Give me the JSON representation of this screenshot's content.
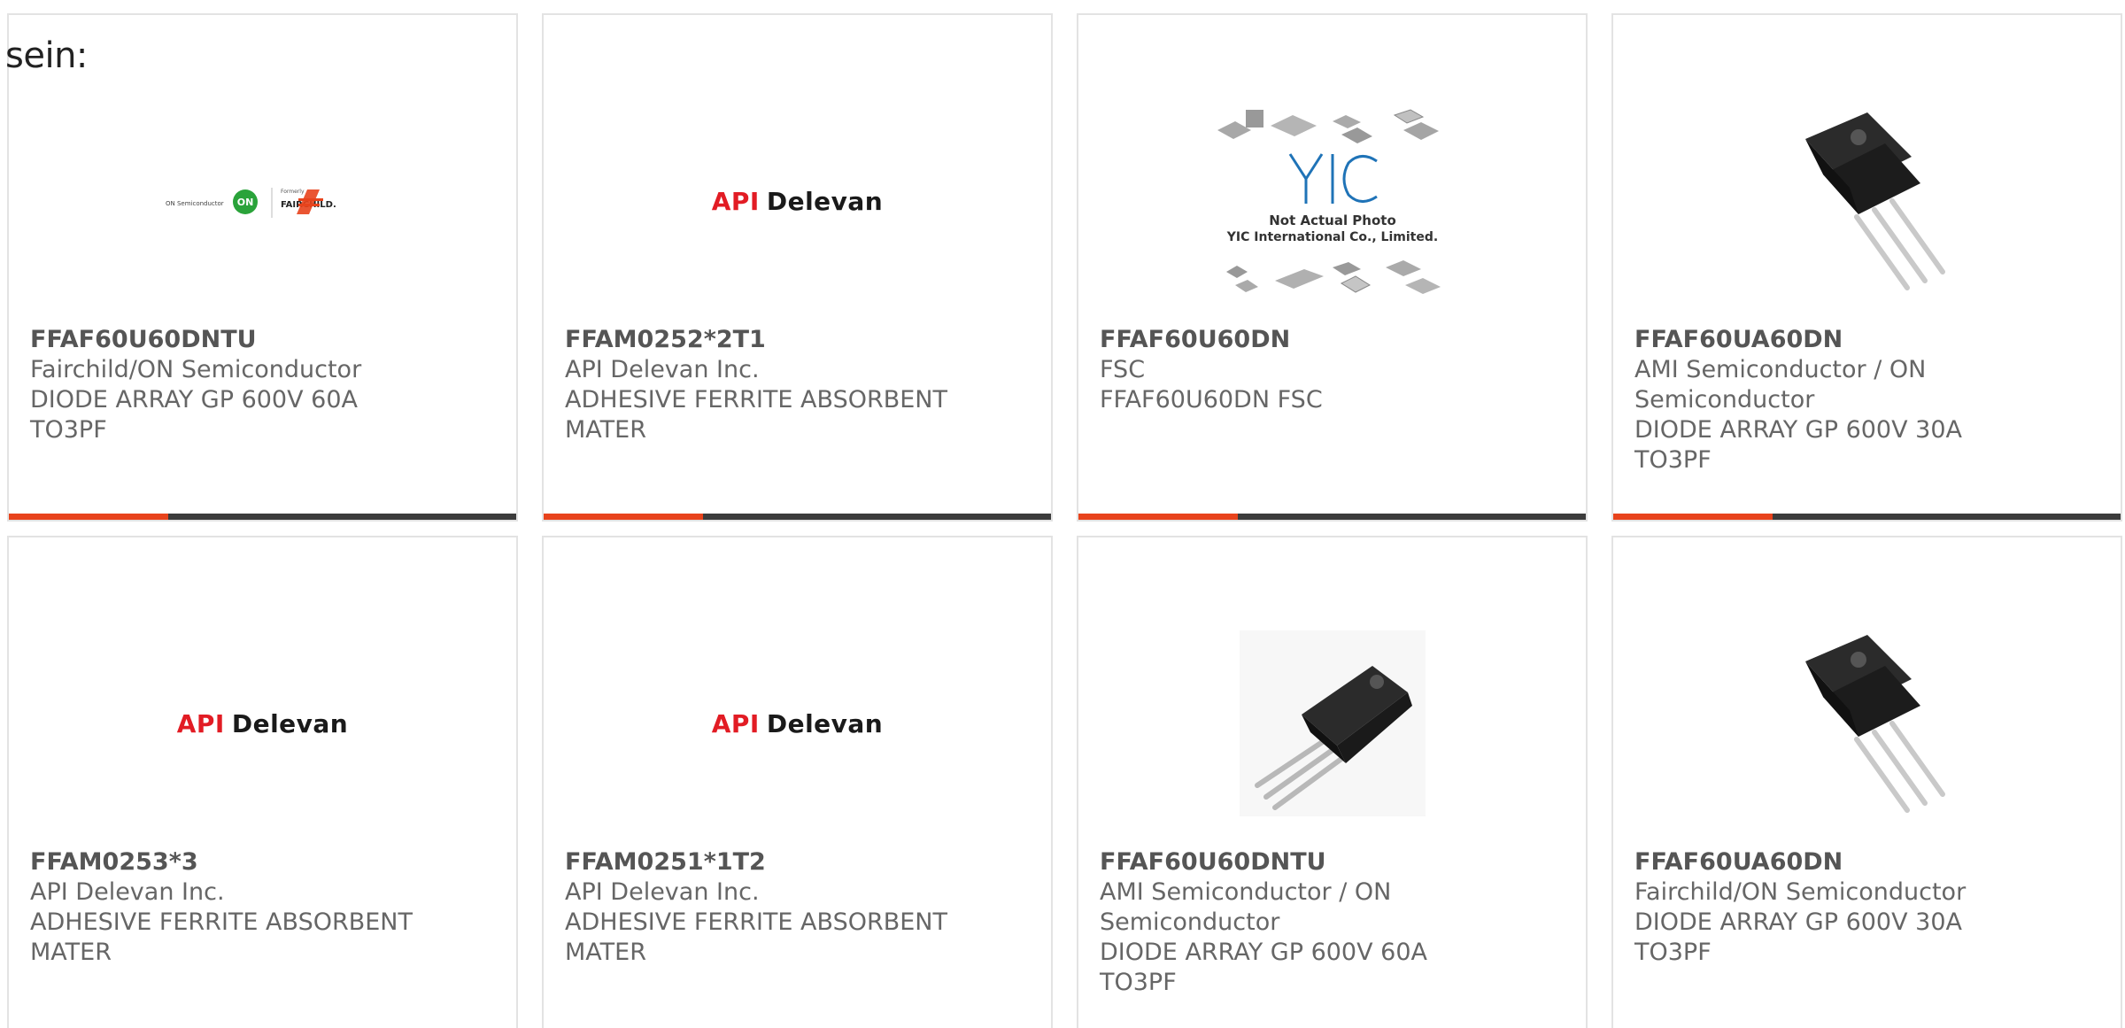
{
  "intro_text": "sein:",
  "colors": {
    "accent": "#e8431c",
    "bar": "#3c3c3c",
    "text": "#666666",
    "api_red": "#e21c24"
  },
  "cards": [
    {
      "image": "onsemi-fairchild-logo",
      "logo_small_1": "ON Semiconductor",
      "logo_small_2": "Formerly",
      "logo_brand": "FAIRCHILD.",
      "part_number": "FFAF60U60DNTU",
      "manufacturer": "Fairchild/ON Semiconductor",
      "description": "DIODE ARRAY GP 600V 60A TO3PF"
    },
    {
      "image": "api-delevan-logo",
      "logo_api": "API",
      "logo_delevan": "Delevan",
      "part_number": "FFAM0252*2T1",
      "manufacturer": "API Delevan Inc.",
      "description": "ADHESIVE FERRITE ABSORBENT MATER"
    },
    {
      "image": "yic-not-actual-photo",
      "logo_yic": "YIC",
      "photo_line1": "Not Actual Photo",
      "photo_line2": "YIC International Co., Limited.",
      "part_number": "FFAF60U60DN",
      "manufacturer": "FSC",
      "description": "FFAF60U60DN FSC"
    },
    {
      "image": "to3pf-transistor-photo",
      "part_number": "FFAF60UA60DN",
      "manufacturer": "AMI Semiconductor / ON Semiconductor",
      "description": "DIODE ARRAY GP 600V 30A TO3PF"
    },
    {
      "image": "api-delevan-logo",
      "logo_api": "API",
      "logo_delevan": "Delevan",
      "part_number": "FFAM0253*3",
      "manufacturer": "API Delevan Inc.",
      "description": "ADHESIVE FERRITE ABSORBENT MATER"
    },
    {
      "image": "api-delevan-logo",
      "logo_api": "API",
      "logo_delevan": "Delevan",
      "part_number": "FFAM0251*1T2",
      "manufacturer": "API Delevan Inc.",
      "description": "ADHESIVE FERRITE ABSORBENT MATER"
    },
    {
      "image": "to3pf-transistor-photo-alt",
      "part_number": "FFAF60U60DNTU",
      "manufacturer": "AMI Semiconductor / ON Semiconductor",
      "description": "DIODE ARRAY GP 600V 60A TO3PF"
    },
    {
      "image": "to3pf-transistor-photo",
      "part_number": "FFAF60UA60DN",
      "manufacturer": "Fairchild/ON Semiconductor",
      "description": "DIODE ARRAY GP 600V 30A TO3PF"
    }
  ]
}
